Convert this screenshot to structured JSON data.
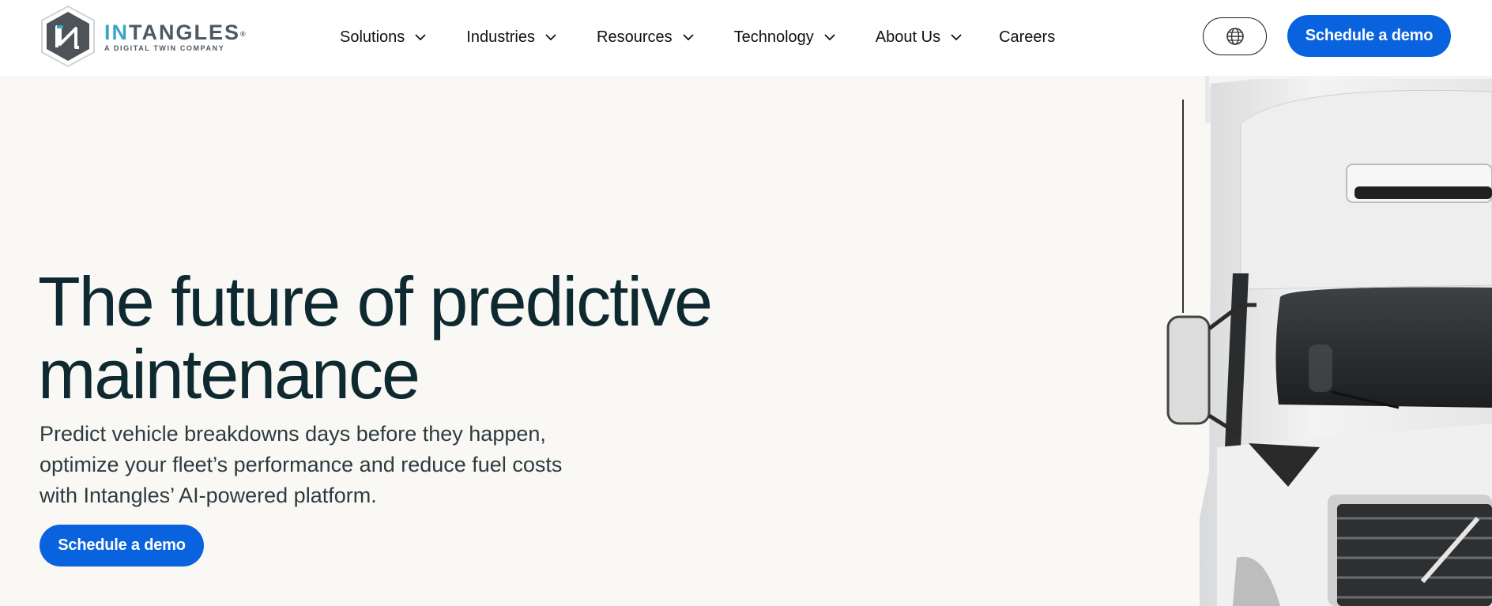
{
  "brand": {
    "name_highlight": "IN",
    "name_rest": "TANGLES",
    "registered": "®",
    "tagline": "A DIGITAL TWIN COMPANY",
    "accent_color": "#3aa6c7"
  },
  "nav": {
    "items": [
      {
        "label": "Solutions",
        "has_dropdown": true
      },
      {
        "label": "Industries",
        "has_dropdown": true
      },
      {
        "label": "Resources",
        "has_dropdown": true
      },
      {
        "label": "Technology",
        "has_dropdown": true
      },
      {
        "label": "About Us",
        "has_dropdown": true
      },
      {
        "label": "Careers",
        "has_dropdown": false
      }
    ]
  },
  "header": {
    "language_icon": "globe-icon",
    "cta_label": "Schedule a demo"
  },
  "hero": {
    "title_line1": "The future of predictive",
    "title_line2": "maintenance",
    "subtitle_line1": "Predict vehicle breakdowns days before they happen,",
    "subtitle_line2": "optimize your fleet’s performance and reduce fuel costs",
    "subtitle_line3": "with Intangles’ AI-powered platform.",
    "cta_label": "Schedule a demo",
    "image": "white-semi-truck-front"
  },
  "colors": {
    "primary_button": "#0a63de",
    "hero_background": "#f9f8f5",
    "heading_text": "#0e2a30"
  }
}
